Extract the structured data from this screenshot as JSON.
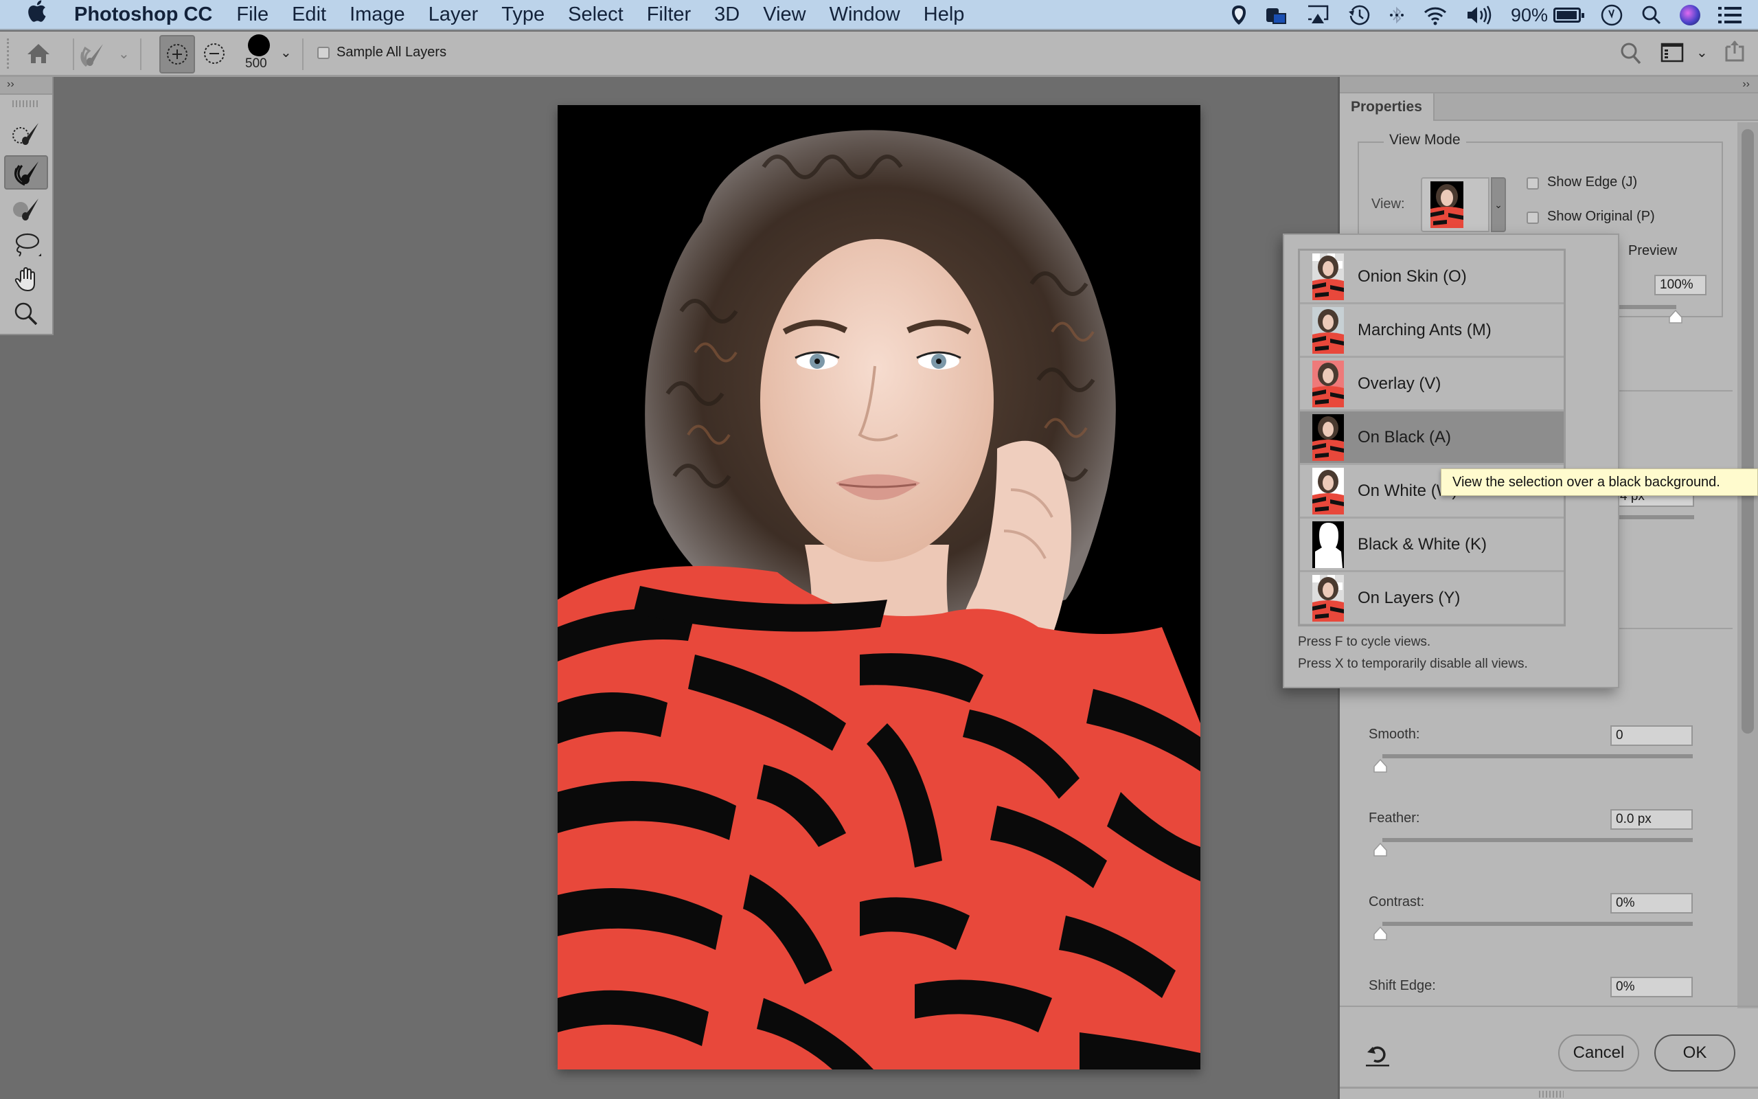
{
  "menubar": {
    "app_name": "Photoshop CC",
    "items": [
      "File",
      "Edit",
      "Image",
      "Layer",
      "Type",
      "Select",
      "Filter",
      "3D",
      "View",
      "Window",
      "Help"
    ],
    "status_icons": [
      "shield-icon",
      "photo-agent-icon",
      "airplay-icon",
      "time-machine-icon",
      "bluetooth-icon",
      "wifi-icon",
      "volume-icon"
    ],
    "battery_percent": "90%"
  },
  "options_bar": {
    "brush_size": "500",
    "sample_all_layers_label": "Sample All Layers",
    "sample_all_layers_checked": false
  },
  "toolbox": {
    "collapse_label": "››",
    "tools": [
      {
        "name": "quick-selection-tool",
        "active": false
      },
      {
        "name": "refine-edge-brush-tool",
        "active": true
      },
      {
        "name": "brush-tool",
        "active": false
      },
      {
        "name": "lasso-tool",
        "active": false
      },
      {
        "name": "hand-tool",
        "active": false
      },
      {
        "name": "zoom-tool",
        "active": false
      }
    ]
  },
  "properties": {
    "collapse_label": "››",
    "tab_label": "Properties",
    "view_mode": {
      "legend": "View Mode",
      "view_label": "View:",
      "show_edge_label": "Show Edge (J)",
      "show_edge_checked": false,
      "show_original_label": "Show Original (P)",
      "show_original_checked": false,
      "preview_label": "Preview",
      "opacity_value": "100%",
      "opacity_fraction": 1.0
    },
    "radius_value_partial": "4 px",
    "fields": [
      {
        "label": "Smooth:",
        "value": "0",
        "fraction": 0
      },
      {
        "label": "Feather:",
        "value": "0.0 px",
        "fraction": 0
      },
      {
        "label": "Contrast:",
        "value": "0%",
        "fraction": 0
      },
      {
        "label": "Shift Edge:",
        "value": "0%"
      }
    ],
    "cancel_label": "Cancel",
    "ok_label": "OK"
  },
  "view_popup": {
    "items": [
      {
        "label": "Onion Skin (O)",
        "thumb": "onion",
        "selected": false
      },
      {
        "label": "Marching Ants (M)",
        "thumb": "ants",
        "selected": false
      },
      {
        "label": "Overlay (V)",
        "thumb": "overlay",
        "selected": false
      },
      {
        "label": "On Black (A)",
        "thumb": "black",
        "selected": true
      },
      {
        "label": "On White (W)",
        "thumb": "white",
        "selected": false
      },
      {
        "label": "Black & White (K)",
        "thumb": "bw",
        "selected": false
      },
      {
        "label": "On Layers (Y)",
        "thumb": "layers",
        "selected": false
      }
    ],
    "hint_1": "Press F to cycle views.",
    "hint_2": "Press X to temporarily disable all views."
  },
  "tooltip": "View the selection over a black background.",
  "colors": {
    "menubar_bg": "#bcd3ea",
    "panel_bg": "#b8b8b8",
    "canvas_bg": "#6d6d6d",
    "selected_item": "#8d8d8d",
    "tooltip_bg": "#fffbce",
    "dress_red": "#e8483b"
  }
}
